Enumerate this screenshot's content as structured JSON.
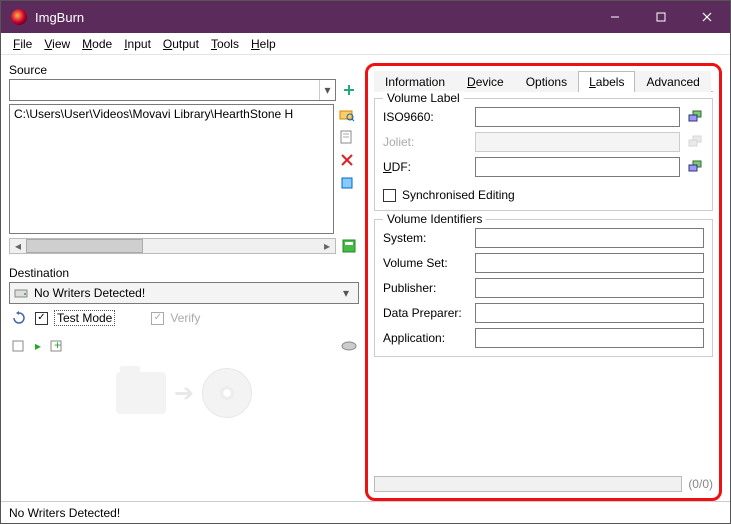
{
  "window": {
    "title": "ImgBurn"
  },
  "menu": {
    "file": "File",
    "view": "View",
    "mode": "Mode",
    "input": "Input",
    "output": "Output",
    "tools": "Tools",
    "help": "Help"
  },
  "source": {
    "label": "Source",
    "combo_value": "",
    "list_item": "C:\\Users\\User\\Videos\\Movavi Library\\HearthStone  H",
    "icons": {
      "add": "add-icon",
      "browse": "folder-search-icon",
      "edit": "edit-icon",
      "remove": "remove-icon",
      "props": "props-icon",
      "calc": "calc-icon"
    }
  },
  "destination": {
    "label": "Destination",
    "value": "No Writers Detected!",
    "test_mode": "Test Mode",
    "verify": "Verify"
  },
  "tabs": {
    "information": "Information",
    "device": "Device",
    "options": "Options",
    "labels": "Labels",
    "advanced": "Advanced"
  },
  "volume_label": {
    "legend": "Volume Label",
    "iso9660": "ISO9660:",
    "joliet": "Joliet:",
    "udf": "UDF:",
    "sync": "Synchronised Editing",
    "values": {
      "iso9660": "",
      "joliet": "",
      "udf": ""
    }
  },
  "volume_identifiers": {
    "legend": "Volume Identifiers",
    "system": "System:",
    "volume_set": "Volume Set:",
    "publisher": "Publisher:",
    "data_preparer": "Data Preparer:",
    "application": "Application:",
    "values": {
      "system": "",
      "volume_set": "",
      "publisher": "",
      "data_preparer": "",
      "application": ""
    }
  },
  "progress": {
    "text": "(0/0)"
  },
  "status": {
    "text": "No Writers Detected!"
  }
}
